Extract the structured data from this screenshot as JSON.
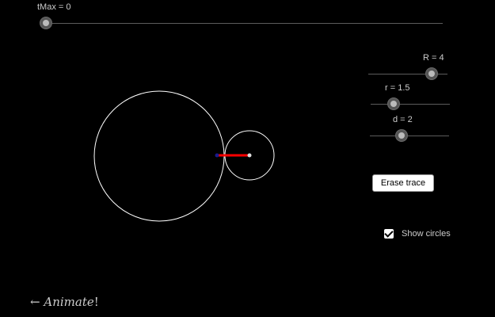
{
  "sliders": {
    "tmax": {
      "label": "tMax = 0",
      "value": 0
    },
    "R": {
      "label": "R = 4",
      "value": 4
    },
    "r": {
      "label": "r = 1.5",
      "value": 1.5
    },
    "d": {
      "label": "d = 2",
      "value": 2
    }
  },
  "buttons": {
    "erase_label": "Erase trace"
  },
  "checkbox": {
    "label": "Show circles",
    "checked": true
  },
  "animate": {
    "arrow": "←",
    "word": "Animate",
    "bang": "!"
  },
  "colors": {
    "background": "#000000",
    "circle_stroke": "#ffffff",
    "radius_arm": "#ff0000",
    "center_point": "#1a1a8c",
    "pen_point": "#dddddd"
  }
}
